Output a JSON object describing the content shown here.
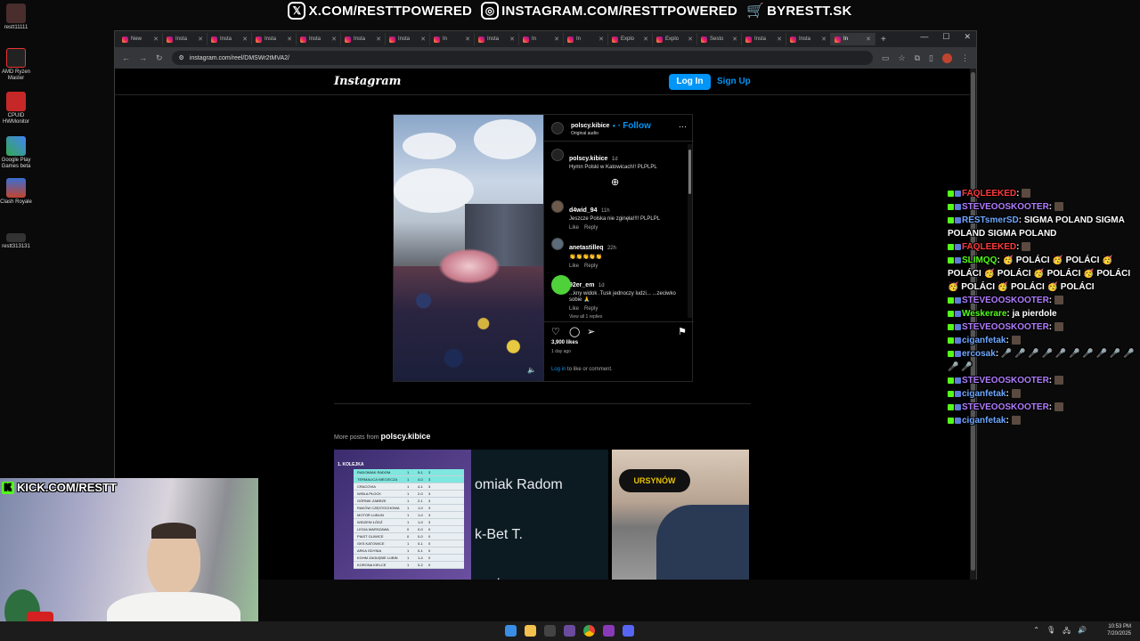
{
  "banner": {
    "x_link": "X.COM/RESTTPOWERED",
    "instagram_link": "INSTAGRAM.COM/RESTTPOWERED",
    "shop_link": "BYRESTT.SK"
  },
  "desktop": {
    "icons": [
      {
        "label": "restt11111"
      },
      {
        "label": "AMD Ryzen Master"
      },
      {
        "label": "CPUID HWMonitor"
      },
      {
        "label": "Google Play Games beta"
      },
      {
        "label": "Clash Royale"
      },
      {
        "label": "restt313131"
      }
    ]
  },
  "browser": {
    "tabs": [
      "New",
      "Insta",
      "Insta",
      "Insta",
      "Insta",
      "Insta",
      "Insta",
      "In",
      "Insta",
      "In",
      "In",
      "Explo",
      "Explo",
      "Sesto",
      "Insta",
      "Insta",
      "In"
    ],
    "url": "instagram.com/reel/DMSWr2tMVA2/"
  },
  "instagram": {
    "logo": "Instagram",
    "login_label": "Log In",
    "signup_label": "Sign Up",
    "post": {
      "username": "polscy.kibice",
      "follow_label": "Follow",
      "audio": "Original audio",
      "caption_user": "polscy.kibice",
      "caption_time": "1d",
      "caption_text": "Hymn Polski w Katowicach!! PLPLPL",
      "comments": [
        {
          "user": "d4wid_94",
          "time": "11h",
          "text": "Jeszcze Polska nie zginęła!!!! PLPLPL",
          "like": "Like",
          "reply": "Reply"
        },
        {
          "user": "anetastilleq",
          "time": "22h",
          "text": "👏👏👏👏👏",
          "like": "Like",
          "reply": "Reply"
        },
        {
          "user": "92er_em",
          "time": "1d",
          "text": "...kny widok .Tusk jednoczy ludzi... ...zeciwko sobie 🙏",
          "like": "Like",
          "reply": "Reply"
        }
      ],
      "view_replies": "View all 1 replies",
      "likes": "3,900 likes",
      "time_ago": "1 day ago",
      "login_prompt_link": "Log in",
      "login_prompt_text": " to like or comment."
    },
    "more_posts_label": "More posts from",
    "more_posts_user": "polscy.kibice",
    "thumb1": {
      "title": "1. KOLEJKA",
      "rows": [
        [
          "RADOMIAK RADOM",
          "1",
          "5-1",
          "3"
        ],
        [
          "TERMALICA NIECIECZA",
          "1",
          "4-0",
          "3"
        ],
        [
          "CRACOVIA",
          "1",
          "4-1",
          "3"
        ],
        [
          "WISŁA PŁOCK",
          "1",
          "2-0",
          "3"
        ],
        [
          "GÓRNIK ZABRZE",
          "1",
          "2-1",
          "3"
        ],
        [
          "RAKÓW CZĘSTOCHOWA",
          "1",
          "1-0",
          "3"
        ],
        [
          "MOTOR LUBLIN",
          "1",
          "1-0",
          "3"
        ],
        [
          "WIDZEW ŁÓDŹ",
          "1",
          "1-0",
          "3"
        ],
        [
          "LEGIA WARSZAWA",
          "0",
          "0-0",
          "0"
        ],
        [
          "PIAST GLIWICE",
          "0",
          "0-0",
          "0"
        ],
        [
          "GKS KATOWICE",
          "1",
          "0-1",
          "0"
        ],
        [
          "ARKA GDYNIA",
          "1",
          "0-1",
          "0"
        ],
        [
          "KGHM ZAGŁĘBIE LUBIN",
          "1",
          "1-4",
          "0"
        ],
        [
          "KORONA KIELCE",
          "1",
          "0-2",
          "0"
        ]
      ]
    },
    "thumb2": {
      "lines": [
        "omiak Radom",
        "k-Bet T.",
        "covia"
      ]
    },
    "thumb3": {
      "text": "URSYNÓW"
    }
  },
  "chat": {
    "messages": [
      {
        "user": "FAQLEEKED",
        "text": "",
        "user_color": "#ff3b3b"
      },
      {
        "user": "STEVEOOSKOOTER",
        "text": "",
        "user_color": "#b07cff"
      },
      {
        "user": "RESTsmerSD",
        "text": "SIGMA POLAND SIGMA POLAND SIGMA POLAND",
        "user_color": "#6ea8ff"
      },
      {
        "user": "FAQLEEKED",
        "text": "",
        "user_color": "#ff3b3b"
      },
      {
        "user": "SLIMQQ",
        "text": "🥳 POLÁCI 🥳 POLÁCI 🥳 POLÁCI 🥳 POLÁCI 🥳 POLÁCI 🥳 POLÁCI 🥳 POLÁCI 🥳 POLÁCI 🥳 POLÁCI",
        "user_color": "#53fc18"
      },
      {
        "user": "STEVEOOSKOOTER",
        "text": "",
        "user_color": "#b07cff"
      },
      {
        "user": "Weskerare",
        "text": "ja pierdole",
        "user_color": "#53fc18"
      },
      {
        "user": "STEVEOOSKOOTER",
        "text": "",
        "user_color": "#b07cff"
      },
      {
        "user": "ciganfetak",
        "text": "",
        "user_color": "#6ea8ff"
      },
      {
        "user": "ercosak",
        "text": "🎤 🎤 🎤 🎤 🎤 🎤 🎤 🎤 🎤 🎤 🎤 🎤",
        "user_color": "#6ea8ff"
      },
      {
        "user": "STEVEOOSKOOTER",
        "text": "",
        "user_color": "#b07cff"
      },
      {
        "user": "ciganfetak",
        "text": "",
        "user_color": "#6ea8ff"
      },
      {
        "user": "STEVEOOSKOOTER",
        "text": "",
        "user_color": "#b07cff"
      },
      {
        "user": "ciganfetak",
        "text": "",
        "user_color": "#6ea8ff"
      }
    ]
  },
  "stream": {
    "kick_label": "KICK.COM/RESTT"
  },
  "taskbar": {
    "time": "10:53 PM",
    "date": "7/20/2025"
  },
  "colors": {
    "ig_blue": "#0095f6",
    "kick_green": "#53fc18"
  }
}
